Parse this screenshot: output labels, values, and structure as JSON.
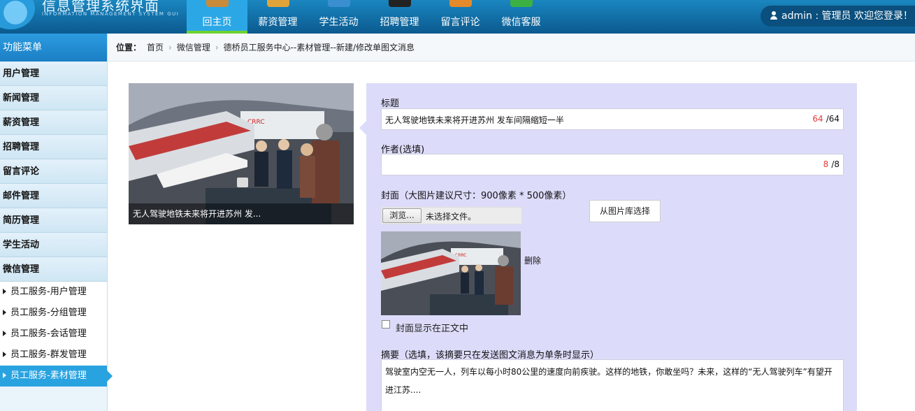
{
  "header": {
    "title": "信息管理系统界面",
    "subtitle": "INFORMATION MANAGEMENT SYSTEM GUI",
    "nav": [
      {
        "label": "回主页",
        "icon": "home-icon",
        "color": "#c98a3a",
        "active": true
      },
      {
        "label": "薪资管理",
        "icon": "salary-icon",
        "color": "#e0a33a",
        "active": false
      },
      {
        "label": "学生活动",
        "icon": "activity-icon",
        "color": "#3a8fd1",
        "active": false
      },
      {
        "label": "招聘管理",
        "icon": "recruit-icon",
        "color": "#222222",
        "active": false
      },
      {
        "label": "留言评论",
        "icon": "comment-icon",
        "color": "#e58a2a",
        "active": false
      },
      {
        "label": "微信客服",
        "icon": "wechat-icon",
        "color": "#3cb043",
        "active": false
      }
    ],
    "user_text": "admin : 管理员  欢迎您登录！"
  },
  "sidebar": {
    "title": "功能菜单",
    "items": [
      "用户管理",
      "新闻管理",
      "薪资管理",
      "招聘管理",
      "留言评论",
      "邮件管理",
      "简历管理",
      "学生活动",
      "微信管理"
    ],
    "subitems": [
      {
        "label": "员工服务-用户管理",
        "active": false
      },
      {
        "label": "员工服务-分组管理",
        "active": false
      },
      {
        "label": "员工服务-会话管理",
        "active": false
      },
      {
        "label": "员工服务-群发管理",
        "active": false
      },
      {
        "label": "员工服务-素材管理",
        "active": true
      }
    ]
  },
  "breadcrumb": {
    "label": "位置：",
    "items": [
      "首页",
      "微信管理",
      "德桥员工服务中心--素材管理--新建/修改单图文消息"
    ]
  },
  "preview": {
    "caption": "无人驾驶地铁未来将开进苏州 发..."
  },
  "form": {
    "title_label": "标题",
    "title_value": "无人驾驶地铁未来将开进苏州 发车间隔缩短一半",
    "title_count": "64",
    "title_max": "/64",
    "author_label": "作者(选填)",
    "author_value": "",
    "author_count": "8",
    "author_max": "/8",
    "cover_label": "封面（大图片建议尺寸：900像素 * 500像素）",
    "file_button": "浏览...",
    "file_status": "未选择文件。",
    "library_button": "从图片库选择",
    "delete_label": "删除",
    "show_cover_label": "封面显示在正文中",
    "summary_label": "摘要（选填，该摘要只在发送图文消息为单条时显示）",
    "summary_value": "驾驶室内空无一人，列车以每小时80公里的速度向前疾驶。这样的地铁，你敢坐吗？未来，这样的“无人驾驶列车”有望开进江苏...."
  }
}
